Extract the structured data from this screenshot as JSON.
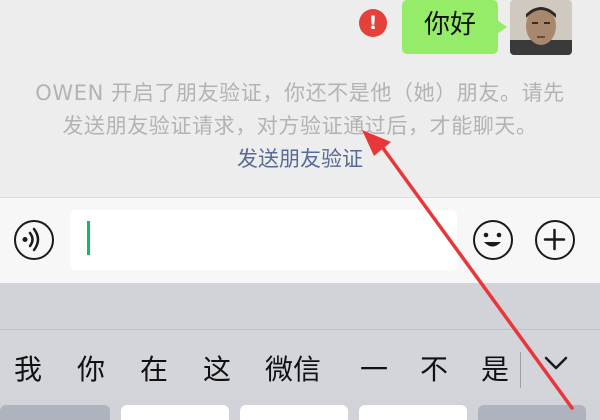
{
  "chat": {
    "message": "你好",
    "notice": "OWEN 开启了朋友验证，你还不是他（她）朋友。请先发送朋友验证请求，对方验证通过后，才能聊天。",
    "send_request_link": "发送朋友验证"
  },
  "icons": {
    "error": "error-icon",
    "voice": "voice-icon",
    "emoji": "emoji-icon",
    "plus": "plus-icon",
    "chevron": "chevron-down-icon"
  },
  "colors": {
    "bubble": "#95ec69",
    "error": "#e5413a",
    "link": "#576b95",
    "cursor": "#07c160",
    "annotation_arrow": "#e8373a"
  },
  "keyboard": {
    "candidates": [
      "我",
      "你",
      "在",
      "这",
      "微信",
      "一",
      "不",
      "是"
    ]
  }
}
